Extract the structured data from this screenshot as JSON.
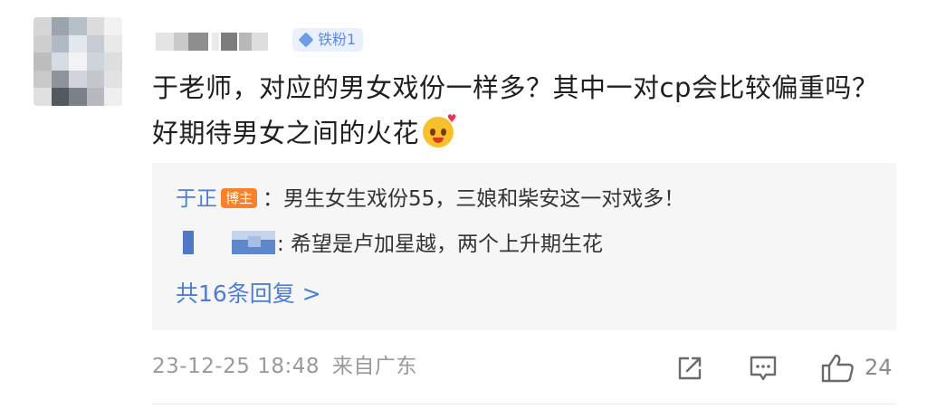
{
  "user": {
    "fan_badge": "铁粉1"
  },
  "comment": {
    "text": "于老师，对应的男女戏份一样多？其中一对cp会比较偏重吗？好期待男女之间的火花"
  },
  "replies": [
    {
      "author": "于正",
      "tag": "博主",
      "separator": "：",
      "text": "男生女生戏份55，三娘和柴安这一对戏多！"
    },
    {
      "separator": ":",
      "text": " 希望是卢加星越，两个上升期生花"
    }
  ],
  "more_replies": "共16条回复 >",
  "meta": {
    "time": "23-12-25 18:48",
    "source": "来自广东"
  },
  "actions": {
    "like_count": "24",
    "icons": [
      "share-icon",
      "comment-icon",
      "like-icon"
    ]
  },
  "colors": {
    "link_blue": "#4e7ed0",
    "host_tag": "#f7822b",
    "fan_badge_bg": "#eaf1fd"
  }
}
